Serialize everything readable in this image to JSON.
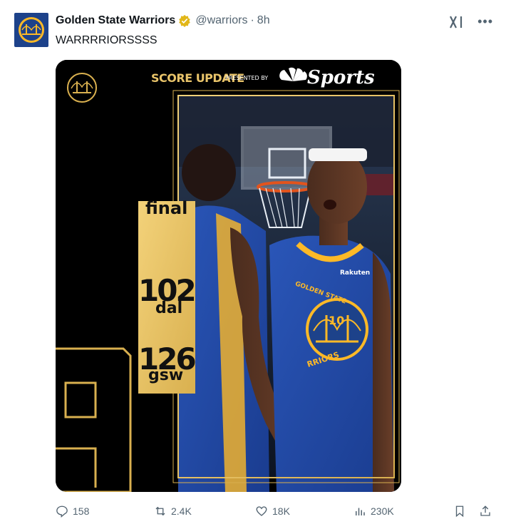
{
  "tweet": {
    "author_name": "Golden State Warriors",
    "handle": "@warriors",
    "separator": "·",
    "time": "8h",
    "text": "WARRRRIORSSSS"
  },
  "icons": {
    "avatar": "warriors-bridge-logo",
    "verified": "gold-verified-badge-icon",
    "grok": "grok-icon",
    "more": "more-icon"
  },
  "media": {
    "header_label": "SCORE UPDATE",
    "presented_by": "PRESENTED BY",
    "sponsor": "Sports",
    "status": "final",
    "team1_score": "102",
    "team1_abbr": "dal",
    "team2_score": "126",
    "team2_abbr": "gsw",
    "jersey_text": "GOLDEN STATE",
    "jersey_text_bottom": "RRIORS",
    "jersey_number": "10",
    "sponsor_patch": "Rakuten"
  },
  "actions": {
    "replies": "158",
    "reposts": "2.4K",
    "likes": "18K",
    "views": "230K"
  },
  "colors": {
    "gold": "#e9c46a",
    "warriors_blue": "#1d428a",
    "text_secondary": "#536471",
    "verified_gold": "#e2b719"
  }
}
